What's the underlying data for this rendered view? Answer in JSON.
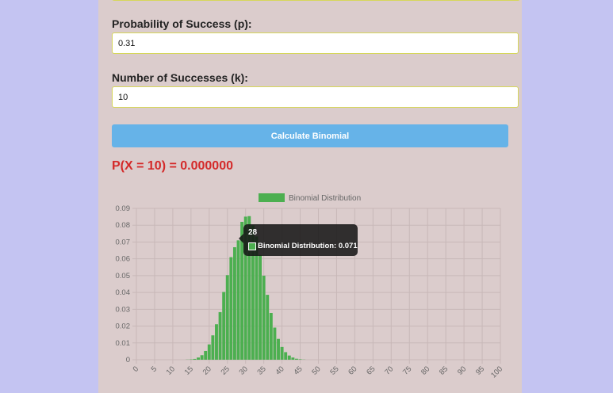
{
  "form": {
    "p_label": "Probability of Success (p):",
    "p_value": "0.31",
    "k_label": "Number of Successes (k):",
    "k_value": "10",
    "button_label": "Calculate Binomial"
  },
  "result": {
    "text": "P(X = 10) = 0.000000"
  },
  "colors": {
    "bar": "#4caf50",
    "result": "#d42a2a",
    "button": "#66b3e8"
  },
  "tooltip": {
    "title": "28",
    "body": "Binomial Distribution: 0.071"
  },
  "chart_data": {
    "type": "bar",
    "x": [
      0,
      1,
      2,
      3,
      4,
      5,
      6,
      7,
      8,
      9,
      10,
      11,
      12,
      13,
      14,
      15,
      16,
      17,
      18,
      19,
      20,
      21,
      22,
      23,
      24,
      25,
      26,
      27,
      28,
      29,
      30,
      31,
      32,
      33,
      34,
      35,
      36,
      37,
      38,
      39,
      40,
      41,
      42,
      43,
      44,
      45,
      46,
      47,
      48,
      49,
      50,
      51,
      52,
      53,
      54,
      55,
      56,
      57,
      58,
      59,
      60,
      61,
      62,
      63,
      64,
      65,
      66,
      67,
      68,
      69,
      70,
      71,
      72,
      73,
      74,
      75,
      76,
      77,
      78,
      79,
      80,
      81,
      82,
      83,
      84,
      85,
      86,
      87,
      88,
      89,
      90,
      91,
      92,
      93,
      94,
      95,
      96,
      97,
      98,
      99,
      100
    ],
    "series": [
      {
        "name": "Binomial Distribution",
        "values": [
          0,
          0,
          0,
          0,
          0,
          0,
          0,
          0,
          0,
          0,
          0,
          0,
          0,
          0,
          0.0001,
          0.0002,
          0.0005,
          0.0013,
          0.0027,
          0.0052,
          0.0091,
          0.0145,
          0.0211,
          0.0283,
          0.0403,
          0.0503,
          0.061,
          0.0669,
          0.071,
          0.082,
          0.0851,
          0.0854,
          0.08,
          0.0733,
          0.0623,
          0.05,
          0.0386,
          0.0278,
          0.0191,
          0.0124,
          0.0076,
          0.0045,
          0.0025,
          0.0013,
          0.0006,
          0.0003,
          0.0001,
          0,
          0,
          0,
          0,
          0,
          0,
          0,
          0,
          0,
          0,
          0,
          0,
          0,
          0,
          0,
          0,
          0,
          0,
          0,
          0,
          0,
          0,
          0,
          0,
          0,
          0,
          0,
          0,
          0,
          0,
          0,
          0,
          0,
          0,
          0,
          0,
          0,
          0,
          0,
          0,
          0,
          0,
          0,
          0,
          0,
          0,
          0,
          0,
          0,
          0,
          0,
          0,
          0,
          0
        ]
      }
    ],
    "x_ticks": [
      "0",
      "5",
      "10",
      "15",
      "20",
      "25",
      "30",
      "35",
      "40",
      "45",
      "50",
      "55",
      "60",
      "65",
      "70",
      "75",
      "80",
      "85",
      "90",
      "95",
      "100"
    ],
    "y_ticks": [
      "0",
      "0.01",
      "0.02",
      "0.03",
      "0.04",
      "0.05",
      "0.06",
      "0.07",
      "0.08",
      "0.09"
    ],
    "ylim": [
      0,
      0.09
    ],
    "grid": true,
    "legend": "top"
  }
}
